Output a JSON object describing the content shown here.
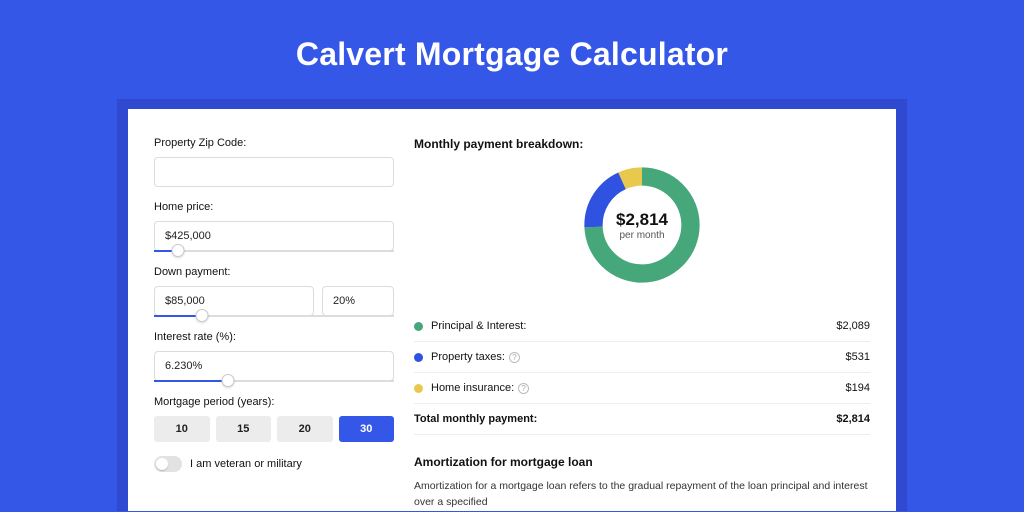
{
  "page": {
    "title": "Calvert Mortgage Calculator"
  },
  "form": {
    "zip_label": "Property Zip Code:",
    "zip_value": "",
    "home_price_label": "Home price:",
    "home_price_value": "$425,000",
    "down_payment_label": "Down payment:",
    "down_payment_value": "$85,000",
    "down_payment_pct": "20%",
    "interest_label": "Interest rate (%):",
    "interest_value": "6.230%",
    "period_label": "Mortgage period (years):",
    "period_options": [
      "10",
      "15",
      "20",
      "30"
    ],
    "period_selected": "30",
    "veteran_label": "I am veteran or military"
  },
  "breakdown": {
    "title": "Monthly payment breakdown:",
    "center_amount": "$2,814",
    "center_sub": "per month",
    "items": [
      {
        "label": "Principal & Interest:",
        "amount": "$2,089",
        "color": "#46a77a",
        "help": false
      },
      {
        "label": "Property taxes:",
        "amount": "$531",
        "color": "#2f52e0",
        "help": true
      },
      {
        "label": "Home insurance:",
        "amount": "$194",
        "color": "#e9c94d",
        "help": true
      }
    ],
    "total_label": "Total monthly payment:",
    "total_amount": "$2,814"
  },
  "amort": {
    "title": "Amortization for mortgage loan",
    "text": "Amortization for a mortgage loan refers to the gradual repayment of the loan principal and interest over a specified"
  },
  "chart_data": {
    "type": "pie",
    "title": "Monthly payment breakdown",
    "series": [
      {
        "name": "Principal & Interest",
        "value": 2089,
        "color": "#46a77a"
      },
      {
        "name": "Property taxes",
        "value": 531,
        "color": "#2f52e0"
      },
      {
        "name": "Home insurance",
        "value": 194,
        "color": "#e9c94d"
      }
    ],
    "total": 2814,
    "center_label": "$2,814 per month"
  }
}
